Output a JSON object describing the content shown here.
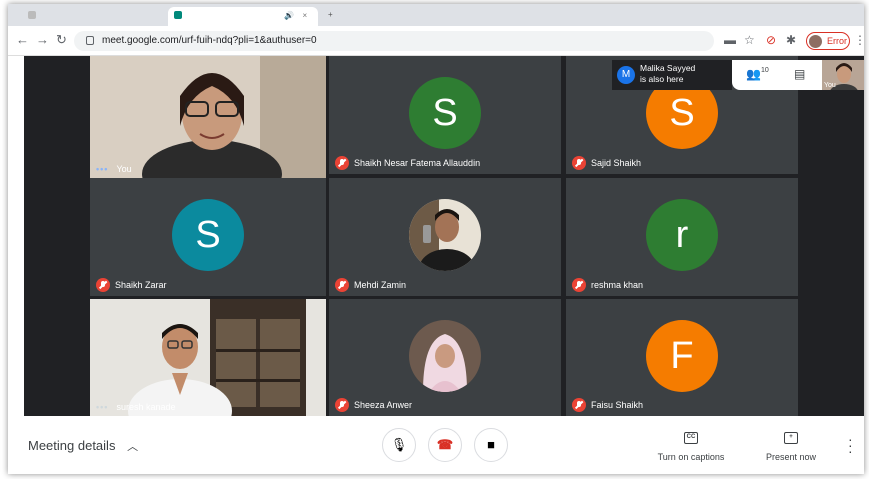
{
  "browser": {
    "url": "meet.google.com/urf-fuih-ndq?pli=1&authuser=0",
    "error_label": "Error"
  },
  "notification": {
    "initial": "M",
    "line1": "Malika Sayyed",
    "line2": "is also here"
  },
  "people_count": "10",
  "self_thumb_label": "You",
  "tiles": [
    {
      "name": "You",
      "kind": "photo"
    },
    {
      "name": "Shaikh Nesar Fatema Allauddin",
      "initial": "S",
      "color": "#2e7d32",
      "kind": "letter"
    },
    {
      "name": "Sajid Shaikh",
      "initial": "S",
      "color": "#f57c00",
      "kind": "letter"
    },
    {
      "name": "Shaikh Zarar",
      "initial": "S",
      "color": "#0b8a9e",
      "kind": "letter"
    },
    {
      "name": "Mehdi Zamin",
      "kind": "photo-avatar"
    },
    {
      "name": "reshma khan",
      "initial": "r",
      "color": "#2e7d32",
      "kind": "letter"
    },
    {
      "name": "suresh kanade",
      "kind": "photo"
    },
    {
      "name": "Sheeza Anwer",
      "kind": "photo-avatar"
    },
    {
      "name": "Faisu Shaikh",
      "initial": "F",
      "color": "#f57c00",
      "kind": "letter"
    }
  ],
  "bottom": {
    "details_label": "Meeting details",
    "captions_label": "Turn on captions",
    "captions_icon": "CC",
    "present_label": "Present now"
  }
}
